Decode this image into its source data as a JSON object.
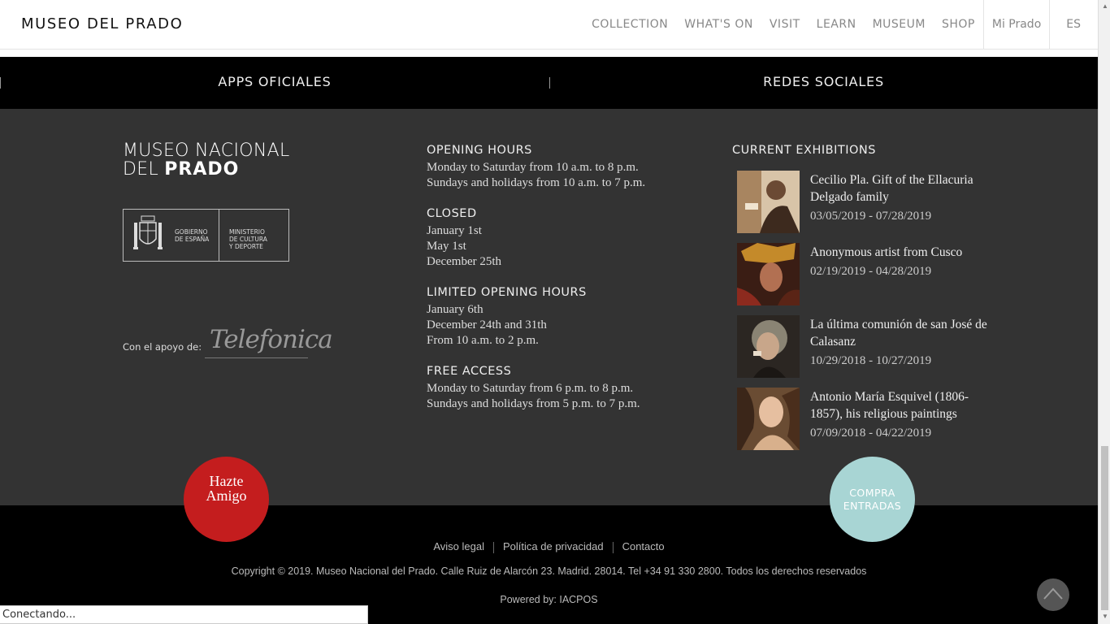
{
  "header": {
    "logo": "MUSEO DEL PRADO",
    "nav": [
      "COLLECTION",
      "WHAT'S ON",
      "VISIT",
      "LEARN",
      "MUSEUM",
      "SHOP"
    ],
    "mi_prado": "Mi Prado",
    "lang": "ES"
  },
  "apps_bar": {
    "apps": "APPS OFICIALES",
    "social": "REDES SOCIALES"
  },
  "brand": {
    "logo_line1": "MUSEO NACIONAL",
    "logo_line2_a": "DEL ",
    "logo_line2_b": "PRADO",
    "gov_left": [
      "GOBIERNO",
      "DE ESPAÑA"
    ],
    "gov_right": [
      "MINISTERIO",
      "DE CULTURA",
      "Y DEPORTE"
    ],
    "support_label": "Con el apoyo de:",
    "sponsor": "Telefonica"
  },
  "hours": {
    "opening_title": "OPENING HOURS",
    "opening": [
      "Monday to Saturday from 10 a.m. to 8 p.m.",
      "Sundays and holidays from 10 a.m. to 7 p.m."
    ],
    "closed_title": "CLOSED",
    "closed": [
      "January 1st",
      "May 1st",
      "December 25th"
    ],
    "limited_title": "LIMITED OPENING HOURS",
    "limited": [
      "January 6th",
      "December 24th and 31th",
      "From 10 a.m. to 2 p.m."
    ],
    "free_title": "FREE ACCESS",
    "free": [
      "Monday to Saturday from 6 p.m. to 8 p.m.",
      "Sundays and holidays from 5 p.m. to 7 p.m."
    ]
  },
  "exhibitions": {
    "title": "CURRENT EXHIBITIONS",
    "items": [
      {
        "title": "Cecilio Pla. Gift of the Ellacuria Delgado family",
        "dates": "03/05/2019 - 07/28/2019"
      },
      {
        "title": "Anonymous artist from Cusco",
        "dates": "02/19/2019 - 04/28/2019"
      },
      {
        "title": "La última comunión de san José de Calasanz",
        "dates": "10/29/2018 - 10/27/2019"
      },
      {
        "title": "Antonio María Esquivel (1806-1857), his religious paintings",
        "dates": "07/09/2018 - 04/22/2019"
      }
    ]
  },
  "cta": {
    "hazte_1": "Hazte",
    "hazte_2": "Amigo",
    "compra_1": "COMPRA",
    "compra_2": "ENTRADAS"
  },
  "bottom": {
    "links": [
      "Aviso legal",
      "Política de privacidad",
      "Contacto"
    ],
    "copyright": "Copyright © 2019. Museo Nacional del Prado. Calle Ruiz de Alarcón 23. Madrid. 28014. Tel +34 91 330 2800. Todos los derechos reservados",
    "powered": "Powered by: IACPOS"
  },
  "status_bar": "Conectando...",
  "colors": {
    "hazte": "#c41d1e",
    "compra": "#a8d5d4",
    "footer_bg": "#333333"
  }
}
